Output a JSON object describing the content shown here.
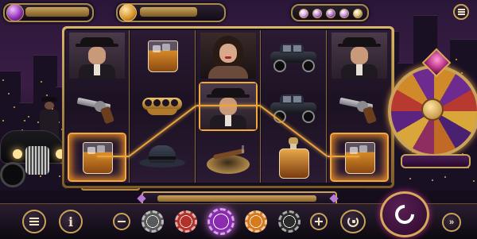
{
  "header": {
    "balance_value": "",
    "bet_value": "",
    "level_dots": [
      "#d7a4f0",
      "#b879d8",
      "#a86ad0",
      "#c58be6",
      "#e0c073"
    ]
  },
  "reels": {
    "columns": [
      [
        "gangster-portrait",
        "revolver",
        "whiskey-glass"
      ],
      [
        "whiskey-glass",
        "brass-knuckles",
        "fedora-hat"
      ],
      [
        "woman-portrait",
        "gangster-portrait",
        "cigar-ashtray"
      ],
      [
        "vintage-car",
        "vintage-car",
        "whiskey-decanter"
      ],
      [
        "gangster-portrait",
        "revolver",
        "whiskey-glass"
      ]
    ],
    "winning_cells": [
      [
        0,
        2
      ],
      [
        2,
        1
      ],
      [
        4,
        2
      ]
    ],
    "colors": {
      "accent": "#e9a33a",
      "frame": "#caa35a",
      "panel": "#140d1a"
    }
  },
  "wheel": {
    "status_value": ""
  },
  "bottom": {
    "win_value": "",
    "chips": [
      {
        "name": "chip-gray",
        "color": "#5a5a5a"
      },
      {
        "name": "chip-red",
        "color": "#b0322a"
      },
      {
        "name": "chip-purple",
        "color": "#8a2bb0"
      },
      {
        "name": "chip-orange",
        "color": "#d67a1d"
      },
      {
        "name": "chip-black",
        "color": "#2a2a2a"
      }
    ],
    "selected_chip": 2
  }
}
